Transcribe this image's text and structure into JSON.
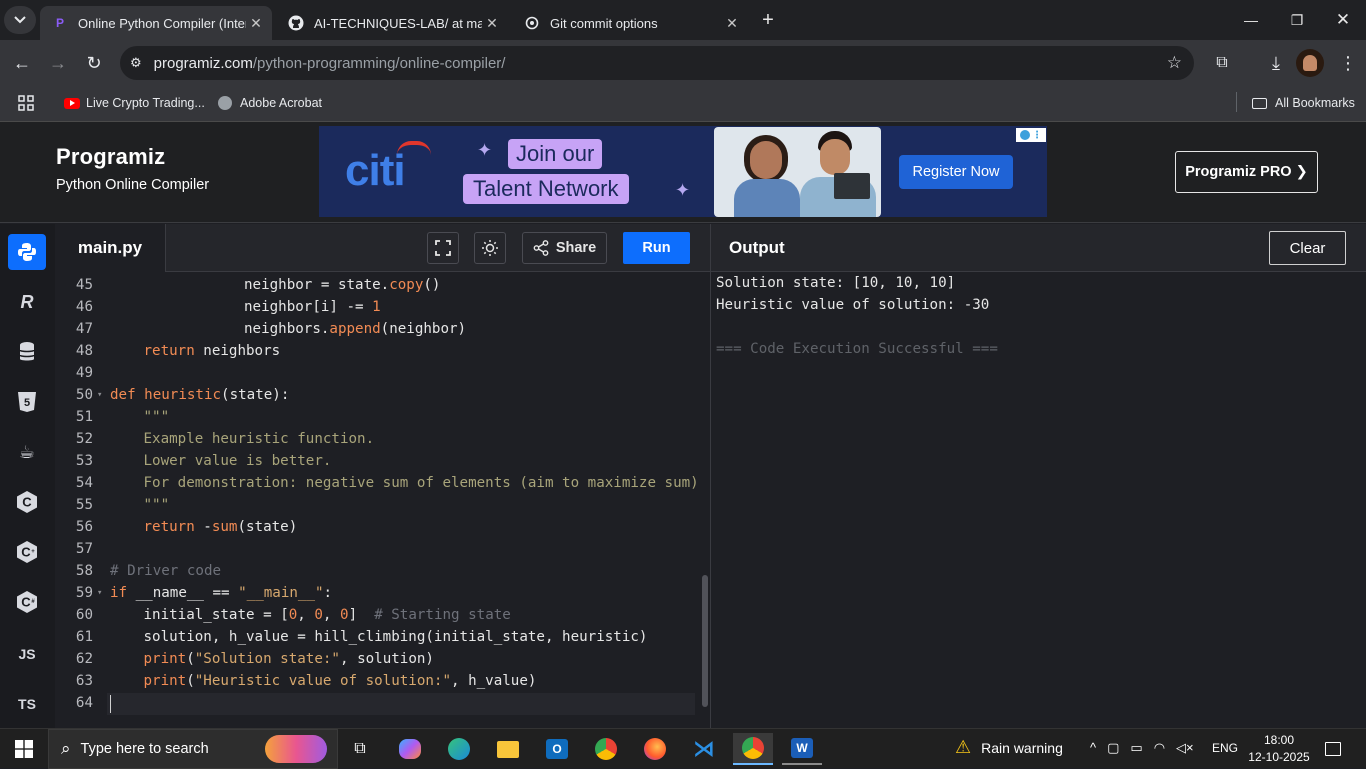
{
  "browser": {
    "tabs": [
      {
        "title": "Online Python Compiler (Interpreter)",
        "active": true
      },
      {
        "title": "AI-TECHNIQUES-LAB/ at main · ",
        "active": false
      },
      {
        "title": "Git commit options",
        "active": false
      }
    ],
    "url_domain": "programiz.com",
    "url_path": "/python-programming/online-compiler/",
    "bookmarks": [
      "Live Crypto Trading...",
      "Adobe Acrobat"
    ],
    "all_bookmarks": "All Bookmarks"
  },
  "site": {
    "logo": "Programiz",
    "subtitle": "Python Online Compiler",
    "ad": {
      "brand": "citi",
      "line1": "Join our",
      "line2": "Talent Network",
      "cta": "Register Now"
    },
    "pro_button": "Programiz PRO ❯"
  },
  "sidebar": {
    "languages": [
      {
        "name": "python-icon",
        "glyph": "🐍"
      },
      {
        "name": "r-icon",
        "glyph": "R"
      },
      {
        "name": "sql-icon",
        "glyph": "≡"
      },
      {
        "name": "html-icon",
        "glyph": "5"
      },
      {
        "name": "java-icon",
        "glyph": "☕"
      },
      {
        "name": "c-icon",
        "glyph": "C"
      },
      {
        "name": "cpp-icon",
        "glyph": "C"
      },
      {
        "name": "csharp-icon",
        "glyph": "C"
      },
      {
        "name": "js-icon",
        "glyph": "JS"
      },
      {
        "name": "ts-icon",
        "glyph": "TS"
      }
    ]
  },
  "editor": {
    "filename": "main.py",
    "share_label": "Share",
    "run_label": "Run",
    "lines": [
      {
        "n": "45",
        "indent": 4,
        "tokens": [
          [
            "",
            "neighbor "
          ],
          [
            "op",
            "= "
          ],
          [
            "",
            "state."
          ],
          [
            "f",
            "copy"
          ],
          [
            "",
            "()"
          ]
        ]
      },
      {
        "n": "46",
        "indent": 4,
        "tokens": [
          [
            "",
            "neighbor[i] "
          ],
          [
            "op",
            "-= "
          ],
          [
            "n",
            "1"
          ]
        ]
      },
      {
        "n": "47",
        "indent": 4,
        "tokens": [
          [
            "",
            "neighbors."
          ],
          [
            "f",
            "append"
          ],
          [
            "",
            "(neighbor)"
          ]
        ]
      },
      {
        "n": "48",
        "indent": 1,
        "tokens": [
          [
            "k",
            "return "
          ],
          [
            "",
            "neighbors"
          ]
        ]
      },
      {
        "n": "49",
        "indent": 0,
        "tokens": []
      },
      {
        "n": "50",
        "indent": 0,
        "fold": true,
        "tokens": [
          [
            "k",
            "def "
          ],
          [
            "f",
            "heuristic"
          ],
          [
            "",
            "(state):"
          ]
        ]
      },
      {
        "n": "51",
        "indent": 1,
        "tokens": [
          [
            "doc",
            "\"\"\""
          ]
        ]
      },
      {
        "n": "52",
        "indent": 1,
        "tokens": [
          [
            "doc",
            "Example heuristic function."
          ]
        ]
      },
      {
        "n": "53",
        "indent": 1,
        "tokens": [
          [
            "doc",
            "Lower value is better."
          ]
        ]
      },
      {
        "n": "54",
        "indent": 1,
        "tokens": [
          [
            "doc",
            "For demonstration: negative sum of elements (aim to maximize sum)"
          ]
        ]
      },
      {
        "n": "55",
        "indent": 1,
        "tokens": [
          [
            "doc",
            "\"\"\""
          ]
        ]
      },
      {
        "n": "56",
        "indent": 1,
        "tokens": [
          [
            "k",
            "return "
          ],
          [
            "op",
            "-"
          ],
          [
            "f",
            "sum"
          ],
          [
            "",
            "(state)"
          ]
        ]
      },
      {
        "n": "57",
        "indent": 0,
        "tokens": []
      },
      {
        "n": "58",
        "indent": 0,
        "tokens": [
          [
            "c",
            "# Driver code"
          ]
        ]
      },
      {
        "n": "59",
        "indent": 0,
        "fold": true,
        "tokens": [
          [
            "k",
            "if "
          ],
          [
            "",
            "__name__ "
          ],
          [
            "op",
            "== "
          ],
          [
            "s",
            "\"__main__\""
          ],
          [
            "",
            ":"
          ]
        ]
      },
      {
        "n": "60",
        "indent": 1,
        "tokens": [
          [
            "",
            "initial_state "
          ],
          [
            "op",
            "= "
          ],
          [
            "",
            "["
          ],
          [
            "n",
            "0"
          ],
          [
            "",
            ", "
          ],
          [
            "n",
            "0"
          ],
          [
            "",
            ", "
          ],
          [
            "n",
            "0"
          ],
          [
            "",
            "]  "
          ],
          [
            "c",
            "# Starting state"
          ]
        ]
      },
      {
        "n": "61",
        "indent": 1,
        "tokens": [
          [
            "",
            "solution, h_value "
          ],
          [
            "op",
            "= "
          ],
          [
            "",
            "hill_climbing(initial_state, heuristic)"
          ]
        ]
      },
      {
        "n": "62",
        "indent": 1,
        "tokens": [
          [
            "f",
            "print"
          ],
          [
            "",
            "("
          ],
          [
            "s",
            "\"Solution state:\""
          ],
          [
            "",
            ", solution)"
          ]
        ]
      },
      {
        "n": "63",
        "indent": 1,
        "tokens": [
          [
            "f",
            "print"
          ],
          [
            "",
            "("
          ],
          [
            "s",
            "\"Heuristic value of solution:\""
          ],
          [
            "",
            ", h_value)"
          ]
        ]
      },
      {
        "n": "64",
        "indent": 0,
        "tokens": []
      }
    ]
  },
  "output": {
    "title": "Output",
    "clear_label": "Clear",
    "lines": [
      "Solution state: [10, 10, 10]",
      "Heuristic value of solution: -30",
      "",
      "=== Code Execution Successful ==="
    ]
  },
  "taskbar": {
    "search_placeholder": "Type here to search",
    "weather": "Rain warning",
    "lang": "ENG",
    "time": "18:00",
    "date": "12-10-2025"
  }
}
